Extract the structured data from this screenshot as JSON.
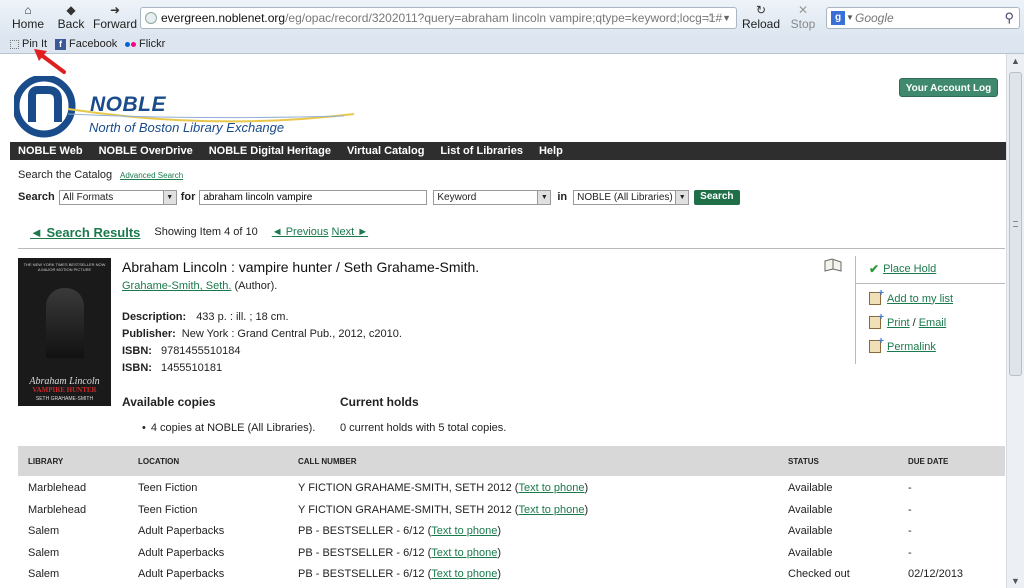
{
  "browser": {
    "home_label": "Home",
    "back_label": "Back",
    "forward_label": "Forward",
    "reload_label": "Reload",
    "stop_label": "Stop",
    "url_domain": "evergreen.noblenet.org",
    "url_prefix": "",
    "url_path": "/eg/opac/record/3202011?query=abraham lincoln vampire;qtype=keyword;locg=1#",
    "search_placeholder": "Google",
    "bookmarks": [
      "Pin It",
      "Facebook",
      "Flickr"
    ]
  },
  "header": {
    "logo_title": "NOBLE",
    "logo_subtitle": "North of Boston Library Exchange",
    "account_button": "Your Account Log in"
  },
  "nav": [
    "NOBLE Web",
    "NOBLE OverDrive",
    "NOBLE Digital Heritage",
    "Virtual Catalog",
    "List of Libraries",
    "Help"
  ],
  "search": {
    "catalog_label": "Search the Catalog",
    "advanced_link": "Advanced Search",
    "search_label": "Search",
    "format_value": "All Formats",
    "for_label": "for",
    "query_value": "abraham lincoln vampire",
    "type_value": "Keyword",
    "in_label": "in",
    "library_value": "NOBLE (All Libraries)",
    "button_label": "Search"
  },
  "results_nav": {
    "back_label": "◄ Search Results",
    "showing": "Showing Item 4 of 10",
    "previous": "◄ Previous",
    "next": "Next ►"
  },
  "record": {
    "title": "Abraham Lincoln : vampire hunter / Seth Grahame-Smith.",
    "author_link": "Grahame-Smith, Seth.",
    "author_role": "(Author).",
    "description_label": "Description:",
    "description": "433 p. : ill. ; 18 cm.",
    "publisher_label": "Publisher:",
    "publisher": "New York : Grand Central Pub., 2012, c2010.",
    "isbn_label": "ISBN:",
    "isbn1": "9781455510184",
    "isbn2": "1455510181",
    "cover": {
      "top_text": "THE NEW YORK TIMES BESTSELLER NOW A MAJOR MOTION PICTURE",
      "title": "Abraham Lincoln",
      "subtitle": "VAMPIRE HUNTER",
      "author": "SETH GRAHAME-SMITH"
    }
  },
  "availability": {
    "copies_heading": "Available copies",
    "copies_value": "4 copies at NOBLE (All Libraries).",
    "holds_heading": "Current holds",
    "holds_value": "0 current holds with 5 total copies."
  },
  "actions": {
    "place_hold": "Place Hold",
    "add_to_list": "Add to my list",
    "print": "Print",
    "slash": "/",
    "email": "Email",
    "permalink": "Permalink"
  },
  "copies_table": {
    "headers": [
      "LIBRARY",
      "LOCATION",
      "CALL NUMBER",
      "STATUS",
      "DUE DATE"
    ],
    "rows": [
      {
        "library": "Marblehead",
        "location": "Teen Fiction",
        "call": "Y FICTION GRAHAME-SMITH, SETH 2012",
        "link": "Text to phone",
        "status": "Available",
        "due": "-"
      },
      {
        "library": "Marblehead",
        "location": "Teen Fiction",
        "call": "Y FICTION GRAHAME-SMITH, SETH 2012",
        "link": "Text to phone",
        "status": "Available",
        "due": "-"
      },
      {
        "library": "Salem",
        "location": "Adult Paperbacks",
        "call": "PB - BESTSELLER - 6/12",
        "link": "Text to phone",
        "status": "Available",
        "due": "-"
      },
      {
        "library": "Salem",
        "location": "Adult Paperbacks",
        "call": "PB - BESTSELLER - 6/12",
        "link": "Text to phone",
        "status": "Available",
        "due": "-"
      },
      {
        "library": "Salem",
        "location": "Adult Paperbacks",
        "call": "PB - BESTSELLER - 6/12",
        "link": "Text to phone",
        "status": "Checked out",
        "due": "02/12/2013"
      }
    ]
  },
  "colors": {
    "brand_blue": "#1a4c8c",
    "link_green": "#1a7a4c",
    "button_green": "#1f7048",
    "nav_bg": "#2e2e2e"
  }
}
